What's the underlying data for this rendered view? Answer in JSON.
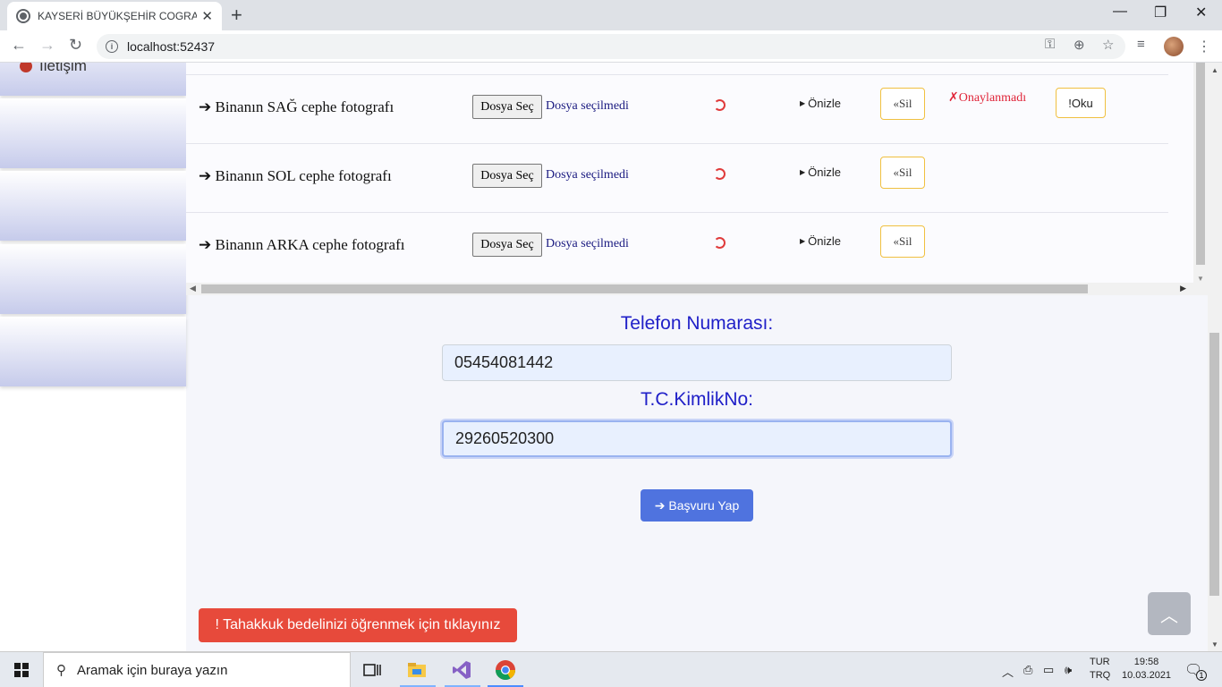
{
  "browser": {
    "tab_title": "KAYSERİ BÜYÜKŞEHİR COGRAFİ B",
    "tab_close": "✕",
    "new_tab": "+",
    "url": "localhost:52437",
    "window_controls": [
      "—",
      "❐",
      "✕"
    ]
  },
  "sidebar": {
    "iletisim_label": "İletişim"
  },
  "rows": [
    {
      "label": "➔ Binanın SAĞ cephe fotografı",
      "file_button": "Dosya Seç",
      "file_status": "Dosya seçilmedi",
      "preview": "Önizle",
      "delete": "«Sil",
      "approval": "✗Onaylanmadı",
      "read": "!Oku"
    },
    {
      "label": "➔ Binanın SOL cephe fotografı",
      "file_button": "Dosya Seç",
      "file_status": "Dosya seçilmedi",
      "preview": "Önizle",
      "delete": "«Sil"
    },
    {
      "label": "➔ Binanın ARKA cephe fotografı",
      "file_button": "Dosya Seç",
      "file_status": "Dosya seçilmedi",
      "preview": "Önizle",
      "delete": "«Sil"
    }
  ],
  "form": {
    "phone_label": "Telefon Numarası:",
    "phone_value": "05454081442",
    "tc_label": "T.C.KimlikNo:",
    "tc_value": "29260520300",
    "submit_label": "➔ Başvuru Yap"
  },
  "alert_button": "! Tahakkuk bedelinizi öğrenmek için tıklayınız",
  "taskbar": {
    "search_placeholder": "Aramak için buraya yazın",
    "language_top": "TUR",
    "language_bottom": "TRQ",
    "time": "19:58",
    "date": "10.03.2021",
    "notification_count": "1"
  }
}
